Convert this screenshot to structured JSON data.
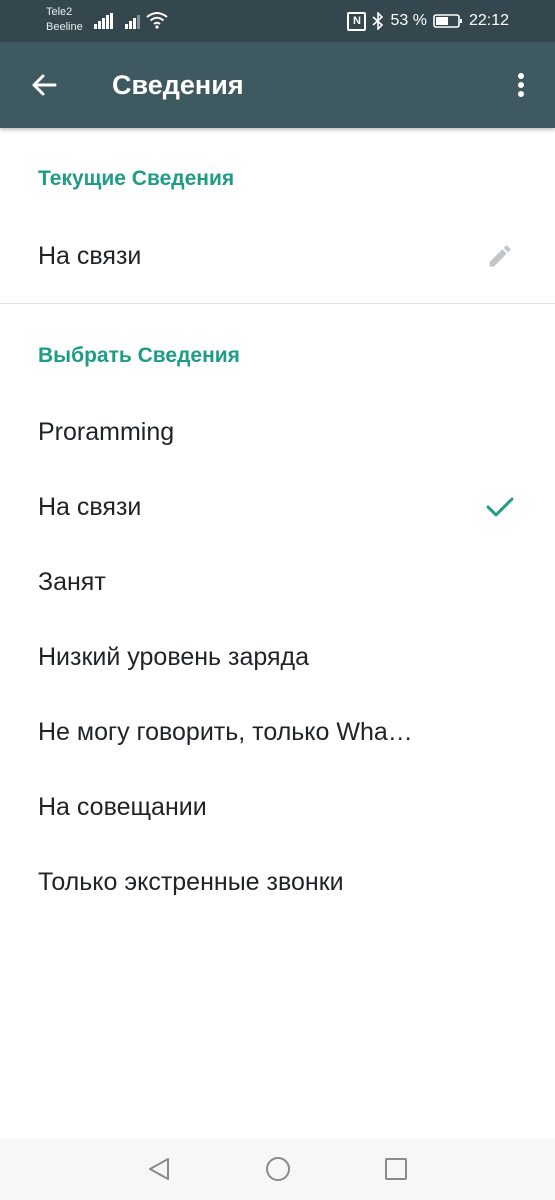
{
  "status_bar": {
    "carrier_1": "Tele2",
    "carrier_2": "Beeline",
    "nfc": "N",
    "battery_percent": "53 %",
    "time": "22:12"
  },
  "app_bar": {
    "title": "Сведения"
  },
  "current_section": {
    "header": "Текущие Сведения",
    "status": "На связи"
  },
  "choose_section": {
    "header": "Выбрать Сведения",
    "items": [
      {
        "label": "Proramming"
      },
      {
        "label": "На связи",
        "selected": true
      },
      {
        "label": "Занят"
      },
      {
        "label": "Низкий уровень заряда"
      },
      {
        "label": "Не могу говорить, только Wha…"
      },
      {
        "label": "На совещании"
      },
      {
        "label": "Только экстренные звонки"
      }
    ]
  },
  "colors": {
    "accent": "#1f9c86",
    "toolbar": "#3f5961",
    "status_bar": "#34474f"
  },
  "icons": {
    "back": "arrow-left-icon",
    "menu": "more-vertical-icon",
    "edit": "pencil-icon",
    "selected": "check-icon",
    "nav_back": "triangle-back-icon",
    "nav_home": "circle-home-icon",
    "nav_recents": "square-recents-icon"
  }
}
